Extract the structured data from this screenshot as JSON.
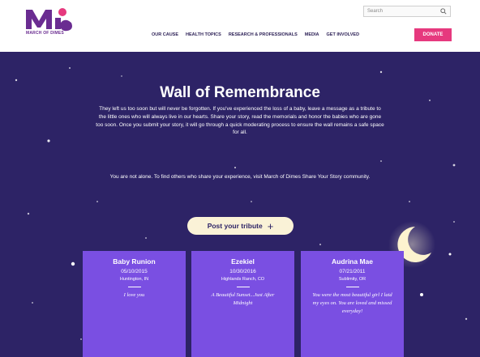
{
  "brand": {
    "logo_text": "MARCH OF DIMES",
    "color": "#6a2c91"
  },
  "search": {
    "placeholder": "Search"
  },
  "nav": {
    "items": [
      {
        "label": "OUR CAUSE"
      },
      {
        "label": "HEALTH TOPICS"
      },
      {
        "label": "RESEARCH & PROFESSIONALS"
      },
      {
        "label": "MEDIA"
      },
      {
        "label": "GET INVOLVED"
      }
    ],
    "donate_label": "DONATE",
    "donate_color": "#e6397e"
  },
  "main": {
    "title": "Wall of Remembrance",
    "intro": "They left us too soon but will never be forgotten. If you've experienced the loss of a baby, leave a message as a tribute to the little ones who will always live in our hearts. Share your story, read the memorials and honor the babies who are gone too soon. Once you submit your story, it will go through a quick moderating process to ensure the wall remains a safe space for all.",
    "cta": "You are not alone. To find others who share your experience, visit March of Dimes Share Your Story community.",
    "post_button": "Post your tribute",
    "background": "#2d2366"
  },
  "cards": [
    {
      "name": "Baby Runion",
      "date": "05/10/2015",
      "place": "Huntington, IN",
      "message": "I love you"
    },
    {
      "name": "Ezekiel",
      "date": "10/30/2016",
      "place": "Highlands Ranch, CO",
      "message": "A Beautiful Sunset...Just After Midnight"
    },
    {
      "name": "Audrina Mae",
      "date": "07/21/2011",
      "place": "Sublimity, OR",
      "message": "You were the most beautiful girl I laid my eyes on. You are loved and missed everyday!"
    }
  ],
  "icons": {
    "search": "search-icon",
    "plus": "plus-icon",
    "moon": "moon-icon"
  }
}
